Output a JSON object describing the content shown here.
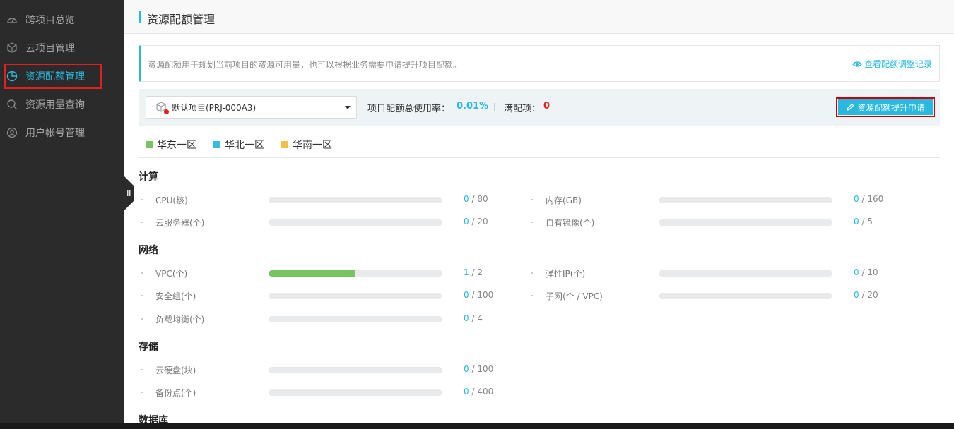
{
  "sidebar": {
    "items": [
      {
        "label": "跨项目总览",
        "icon": "dashboard-icon"
      },
      {
        "label": "云项目管理",
        "icon": "cube-icon"
      },
      {
        "label": "资源配额管理",
        "icon": "pie-chart-icon",
        "active": true
      },
      {
        "label": "资源用量查询",
        "icon": "search-icon"
      },
      {
        "label": "用户帐号管理",
        "icon": "user-icon"
      }
    ]
  },
  "header": {
    "title": "资源配额管理"
  },
  "info": {
    "text": "资源配额用于规划当前项目的资源可用量，也可以根据业务需要申请提升项目配额。",
    "link": "查看配额调整记录"
  },
  "toolbar": {
    "project": "默认项目(PRJ-000A3)",
    "usage_label": "项目配额总使用率：",
    "usage_value": "0.01%",
    "full_label": "满配项：",
    "full_value": "0",
    "apply_button": "资源配额提升申请"
  },
  "legend": [
    {
      "label": "华东一区",
      "color": "#79c462"
    },
    {
      "label": "华北一区",
      "color": "#38b8e4"
    },
    {
      "label": "华南一区",
      "color": "#f4bf45"
    }
  ],
  "sections": [
    {
      "title": "计算",
      "items": [
        {
          "label": "CPU(核)",
          "used": 0,
          "total": 80
        },
        {
          "label": "内存(GB)",
          "used": 0,
          "total": 160
        },
        {
          "label": "云服务器(个)",
          "used": 0,
          "total": 20
        },
        {
          "label": "自有镜像(个)",
          "used": 0,
          "total": 5
        }
      ]
    },
    {
      "title": "网络",
      "items": [
        {
          "label": "VPC(个)",
          "used": 1,
          "total": 2
        },
        {
          "label": "弹性IP(个)",
          "used": 0,
          "total": 10
        },
        {
          "label": "安全组(个)",
          "used": 0,
          "total": 100
        },
        {
          "label": "子网(个 / VPC)",
          "used": 0,
          "total": 20
        },
        {
          "label": "负载均衡(个)",
          "used": 0,
          "total": 4
        }
      ]
    },
    {
      "title": "存储",
      "items": [
        {
          "label": "云硬盘(块)",
          "used": 0,
          "total": 100
        },
        {
          "label": "备份点(个)",
          "used": 0,
          "total": 400
        }
      ]
    },
    {
      "title": "数据库",
      "items": []
    }
  ]
}
